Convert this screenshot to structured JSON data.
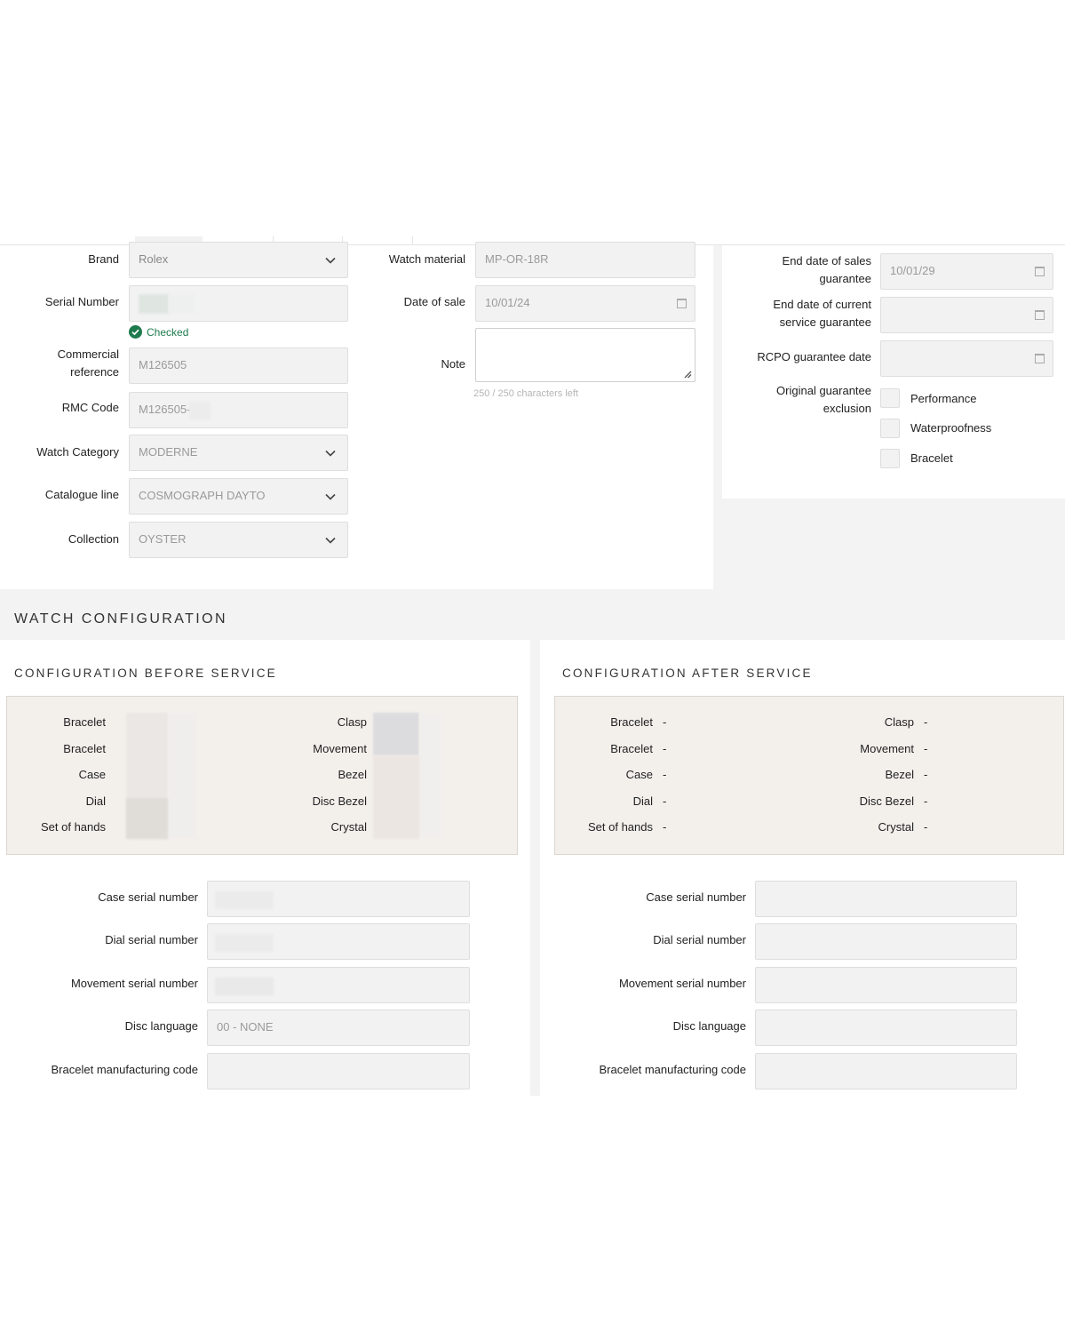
{
  "identification": {
    "brand": {
      "label": "Brand",
      "value": "Rolex"
    },
    "serial_number": {
      "label": "Serial Number",
      "status": "Checked"
    },
    "commercial_reference": {
      "label_line1": "Commercial",
      "label_line2": "reference",
      "value": "M126505"
    },
    "rmc_code": {
      "label": "RMC Code",
      "value": "M126505-"
    },
    "watch_category": {
      "label": "Watch Category",
      "value": "MODERNE"
    },
    "catalogue_line": {
      "label": "Catalogue line",
      "value": "COSMOGRAPH DAYTO"
    },
    "collection": {
      "label": "Collection",
      "value": "OYSTER"
    },
    "watch_material": {
      "label": "Watch material",
      "value": "MP-OR-18R"
    },
    "date_of_sale": {
      "label": "Date of sale",
      "value": "10/01/24"
    },
    "note": {
      "label": "Note",
      "value": "",
      "counter": "250 / 250 characters left"
    }
  },
  "guarantee": {
    "end_sales": {
      "label_line1": "End date of sales",
      "label_line2": "guarantee",
      "value": "10/01/29"
    },
    "end_service": {
      "label_line1": "End date of current",
      "label_line2": "service guarantee",
      "value": ""
    },
    "rcpo": {
      "label": "RCPO guarantee date",
      "value": ""
    },
    "exclusion": {
      "label_line1": "Original guarantee",
      "label_line2": "exclusion",
      "options": [
        "Performance",
        "Waterproofness",
        "Bracelet"
      ]
    }
  },
  "watch_configuration": {
    "title": "WATCH CONFIGURATION",
    "before": {
      "title": "CONFIGURATION BEFORE SERVICE",
      "left_labels": [
        "Bracelet",
        "Bracelet",
        "Case",
        "Dial",
        "Set of hands"
      ],
      "right_labels": [
        "Clasp",
        "Movement",
        "Bezel",
        "Disc Bezel",
        "Crystal"
      ],
      "fields": {
        "case_serial": {
          "label": "Case serial number",
          "value": ""
        },
        "dial_serial": {
          "label": "Dial serial number",
          "value": ""
        },
        "movement_serial": {
          "label": "Movement serial number",
          "value": ""
        },
        "disc_language": {
          "label": "Disc language",
          "value": "00 - NONE"
        },
        "bracelet_code": {
          "label": "Bracelet manufacturing code",
          "value": ""
        }
      }
    },
    "after": {
      "title": "CONFIGURATION AFTER SERVICE",
      "left_labels": [
        "Bracelet",
        "Bracelet",
        "Case",
        "Dial",
        "Set of hands"
      ],
      "right_labels": [
        "Clasp",
        "Movement",
        "Bezel",
        "Disc Bezel",
        "Crystal"
      ],
      "placeholder": "-",
      "fields": {
        "case_serial": {
          "label": "Case serial number",
          "value": ""
        },
        "dial_serial": {
          "label": "Dial serial number",
          "value": ""
        },
        "movement_serial": {
          "label": "Movement serial number",
          "value": ""
        },
        "disc_language": {
          "label": "Disc language",
          "value": ""
        },
        "bracelet_code": {
          "label": "Bracelet manufacturing code",
          "value": ""
        }
      }
    }
  },
  "colors": {
    "page_gray": "#f3f3f3",
    "field_bg": "#f2f2f2",
    "config_box_bg": "#f3f0ec",
    "check_green": "#1e7b4e"
  }
}
